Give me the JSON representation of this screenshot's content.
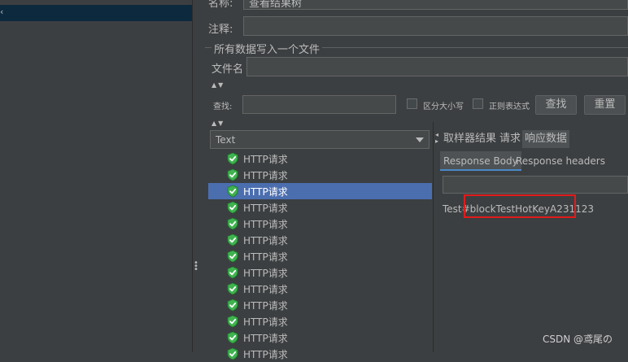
{
  "form": {
    "name_label": "名称:",
    "name_value": "查看结果树",
    "comment_label": "注释:",
    "comment_value": "",
    "file_section_title": "所有数据写入一个文件",
    "filename_label": "文件名",
    "filename_value": ""
  },
  "search": {
    "label": "查找:",
    "value": "",
    "case_sensitive_label": "区分大小写",
    "regex_label": "正则表达式",
    "find_button": "查找",
    "reset_button": "重置"
  },
  "results": {
    "renderer_value": "Text",
    "items": [
      {
        "label": "HTTP请求",
        "selected": false
      },
      {
        "label": "HTTP请求",
        "selected": false
      },
      {
        "label": "HTTP请求",
        "selected": true
      },
      {
        "label": "HTTP请求",
        "selected": false
      },
      {
        "label": "HTTP请求",
        "selected": false
      },
      {
        "label": "HTTP请求",
        "selected": false
      },
      {
        "label": "HTTP请求",
        "selected": false
      },
      {
        "label": "HTTP请求",
        "selected": false
      },
      {
        "label": "HTTP请求",
        "selected": false
      },
      {
        "label": "HTTP请求",
        "selected": false
      },
      {
        "label": "HTTP请求",
        "selected": false
      },
      {
        "label": "HTTP请求",
        "selected": false
      },
      {
        "label": "HTTP请求",
        "selected": false
      }
    ]
  },
  "detail": {
    "tabs": [
      "取样器结果",
      "请求",
      "响应数据"
    ],
    "active_tab": 2,
    "subtabs": [
      "Response Body",
      "Response headers"
    ],
    "active_subtab": 0,
    "search_value": "",
    "body_text": "Test#blockTestHotKeyA231123"
  },
  "watermark": "CSDN @鸢尾の",
  "colors": {
    "background": "#3c3f41",
    "selection": "#4b6eaf",
    "success_icon": "#3fb34f",
    "highlight": "#e21b1b"
  }
}
